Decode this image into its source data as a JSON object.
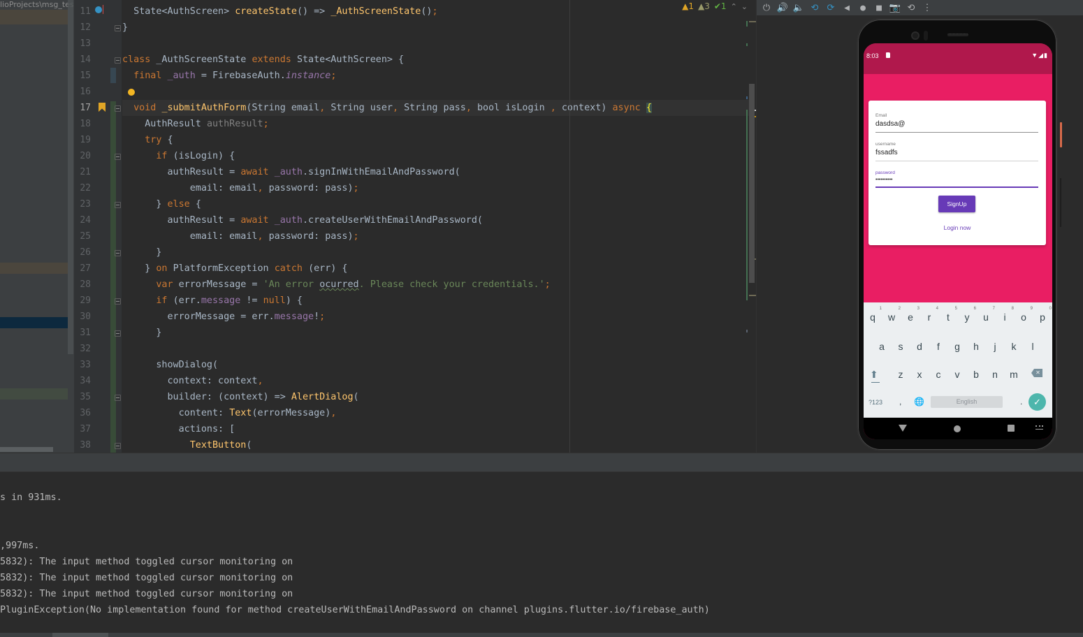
{
  "project_panel": {
    "path": "lioProjects\\msg_test"
  },
  "editor": {
    "inspections": {
      "errors": "1",
      "warnings": "3",
      "ok": "1"
    },
    "current_line": 17,
    "lines": [
      {
        "n": "11",
        "segs": [
          [
            "",
            "  State<AuthScreen> "
          ],
          [
            "fn",
            "createState"
          ],
          [
            "",
            "() => "
          ],
          [
            "fn",
            "_AuthScreenState"
          ],
          [
            "",
            "()"
          ],
          [
            "kw",
            ";"
          ]
        ]
      },
      {
        "n": "12",
        "segs": [
          [
            "",
            "}"
          ]
        ]
      },
      {
        "n": "13",
        "segs": []
      },
      {
        "n": "14",
        "segs": [
          [
            "kw",
            "class "
          ],
          [
            "",
            "_AuthScreenState "
          ],
          [
            "kw",
            "extends "
          ],
          [
            "",
            "State<AuthScreen> {"
          ]
        ]
      },
      {
        "n": "15",
        "segs": [
          [
            "",
            "  "
          ],
          [
            "kw",
            "final "
          ],
          [
            "fld",
            "_auth"
          ],
          [
            "",
            " = FirebaseAuth."
          ],
          [
            "it",
            "instance"
          ],
          [
            "kw",
            ";"
          ]
        ]
      },
      {
        "n": "16",
        "segs": []
      },
      {
        "n": "17",
        "segs": [
          [
            "",
            "  "
          ],
          [
            "kw",
            "void "
          ],
          [
            "fn",
            "_submitAuthForm"
          ],
          [
            "",
            "(String email"
          ],
          [
            "kw",
            ", "
          ],
          [
            "",
            "String user"
          ],
          [
            "kw",
            ", "
          ],
          [
            "",
            "String pass"
          ],
          [
            "kw",
            ", "
          ],
          [
            "",
            "bool isLogin "
          ],
          [
            "kw",
            ", "
          ],
          [
            "",
            "context) "
          ],
          [
            "kw",
            "async "
          ],
          [
            "brace",
            "{"
          ]
        ]
      },
      {
        "n": "18",
        "segs": [
          [
            "",
            "    AuthResult "
          ],
          [
            "unused",
            "authResult"
          ],
          [
            "kw",
            ";"
          ]
        ]
      },
      {
        "n": "19",
        "segs": [
          [
            "",
            "    "
          ],
          [
            "kw",
            "try "
          ],
          [
            "",
            "{"
          ]
        ]
      },
      {
        "n": "20",
        "segs": [
          [
            "",
            "      "
          ],
          [
            "kw",
            "if "
          ],
          [
            "",
            "(isLogin) {"
          ]
        ]
      },
      {
        "n": "21",
        "segs": [
          [
            "",
            "        authResult = "
          ],
          [
            "kw",
            "await "
          ],
          [
            "fld",
            "_auth"
          ],
          [
            "",
            ".signInWithEmailAndPassword("
          ]
        ]
      },
      {
        "n": "22",
        "segs": [
          [
            "",
            "            email: email"
          ],
          [
            "kw",
            ", "
          ],
          [
            "",
            "password: pass)"
          ],
          [
            "kw",
            ";"
          ]
        ]
      },
      {
        "n": "23",
        "segs": [
          [
            "",
            "      } "
          ],
          [
            "kw",
            "else "
          ],
          [
            "",
            "{"
          ]
        ]
      },
      {
        "n": "24",
        "segs": [
          [
            "",
            "        authResult = "
          ],
          [
            "kw",
            "await "
          ],
          [
            "fld",
            "_auth"
          ],
          [
            "",
            ".createUserWithEmailAndPassword("
          ]
        ]
      },
      {
        "n": "25",
        "segs": [
          [
            "",
            "            email: email"
          ],
          [
            "kw",
            ", "
          ],
          [
            "",
            "password: pass)"
          ],
          [
            "kw",
            ";"
          ]
        ]
      },
      {
        "n": "26",
        "segs": [
          [
            "",
            "      }"
          ]
        ]
      },
      {
        "n": "27",
        "segs": [
          [
            "",
            "    } "
          ],
          [
            "kw",
            "on "
          ],
          [
            "",
            "PlatformException "
          ],
          [
            "kw",
            "catch "
          ],
          [
            "",
            "(err) {"
          ]
        ]
      },
      {
        "n": "28",
        "segs": [
          [
            "",
            "      "
          ],
          [
            "kw",
            "var "
          ],
          [
            "",
            "errorMessage = "
          ],
          [
            "str",
            "'An error "
          ],
          [
            "typo",
            "ocurred"
          ],
          [
            "str",
            ". Please check your credentials.'"
          ],
          [
            "kw",
            ";"
          ]
        ]
      },
      {
        "n": "29",
        "segs": [
          [
            "",
            "      "
          ],
          [
            "kw",
            "if "
          ],
          [
            "",
            "(err."
          ],
          [
            "fld",
            "message"
          ],
          [
            "",
            " != "
          ],
          [
            "kw",
            "null"
          ],
          [
            "",
            ") {"
          ]
        ]
      },
      {
        "n": "30",
        "segs": [
          [
            "",
            "        errorMessage = err."
          ],
          [
            "fld",
            "message"
          ],
          [
            "",
            "!"
          ],
          [
            "kw",
            ";"
          ]
        ]
      },
      {
        "n": "31",
        "segs": [
          [
            "",
            "      }"
          ]
        ]
      },
      {
        "n": "32",
        "segs": []
      },
      {
        "n": "33",
        "segs": [
          [
            "",
            "      showDialog("
          ]
        ]
      },
      {
        "n": "34",
        "segs": [
          [
            "",
            "        context: context"
          ],
          [
            "kw",
            ","
          ]
        ]
      },
      {
        "n": "35",
        "segs": [
          [
            "",
            "        builder: (context) => "
          ],
          [
            "fn",
            "AlertDialog"
          ],
          [
            "",
            "("
          ]
        ]
      },
      {
        "n": "36",
        "segs": [
          [
            "",
            "          content: "
          ],
          [
            "fn",
            "Text"
          ],
          [
            "",
            "(errorMessage)"
          ],
          [
            "kw",
            ","
          ]
        ]
      },
      {
        "n": "37",
        "segs": [
          [
            "",
            "          actions: ["
          ]
        ]
      },
      {
        "n": "38",
        "segs": [
          [
            "",
            "            "
          ],
          [
            "fn",
            "TextButton"
          ],
          [
            "",
            "("
          ]
        ]
      }
    ]
  },
  "emulator": {
    "toolbar": [
      {
        "name": "power-icon",
        "glyph": "⏻"
      },
      {
        "name": "volume-up-icon",
        "glyph": "🔊"
      },
      {
        "name": "volume-down-icon",
        "glyph": "🔈"
      },
      {
        "name": "rotate-left-icon",
        "glyph": "⟲"
      },
      {
        "name": "rotate-right-icon",
        "glyph": "⟳"
      },
      {
        "name": "back-icon",
        "glyph": "◀"
      },
      {
        "name": "home-icon",
        "glyph": "●"
      },
      {
        "name": "overview-icon",
        "glyph": "■"
      },
      {
        "name": "screenshot-icon",
        "glyph": "📷"
      },
      {
        "name": "snapshot-icon",
        "glyph": "⟲"
      },
      {
        "name": "more-icon",
        "glyph": "⋮"
      }
    ],
    "phone": {
      "status_time": "8:03",
      "status_icons": "▼◢▮",
      "colors": {
        "primary": "#e91e63",
        "primary_dark": "#b0184c",
        "accent": "#673ab7"
      },
      "form": {
        "email_label": "Email",
        "email_value": "dasdsa@",
        "username_label": "username",
        "username_value": "fssadfs",
        "password_label": "password",
        "password_value": "••••••••••",
        "signup_label": "SignUp",
        "login_label": "Login now"
      },
      "keyboard": {
        "row1": [
          [
            "q",
            "1"
          ],
          [
            "w",
            "2"
          ],
          [
            "e",
            "3"
          ],
          [
            "r",
            "4"
          ],
          [
            "t",
            "5"
          ],
          [
            "y",
            "6"
          ],
          [
            "u",
            "7"
          ],
          [
            "i",
            "8"
          ],
          [
            "o",
            "9"
          ],
          [
            "p",
            "0"
          ]
        ],
        "row2": [
          "a",
          "s",
          "d",
          "f",
          "g",
          "h",
          "j",
          "k",
          "l"
        ],
        "row3": [
          "z",
          "x",
          "c",
          "v",
          "b",
          "n",
          "m"
        ],
        "symbols_label": "?123",
        "comma": ",",
        "space_label": "English",
        "period": ".",
        "enter_glyph": "✓",
        "globe_glyph": "🌐",
        "shift_glyph": "⬆",
        "delete_glyph": "✕"
      }
    }
  },
  "console": {
    "lines": [
      {
        "text": "s in 931ms."
      },
      {
        "text": ""
      },
      {
        "text": ""
      },
      {
        "text": ",997ms."
      },
      {
        "text": "5832): The input method toggled cursor monitoring on"
      },
      {
        "text": "5832): The input method toggled cursor monitoring on"
      },
      {
        "text": "5832): The input method toggled cursor monitoring on"
      },
      {
        "text": "PluginException(No implementation found for method createUserWithEmailAndPassword on channel plugins.flutter.io/firebase_auth)"
      }
    ]
  }
}
